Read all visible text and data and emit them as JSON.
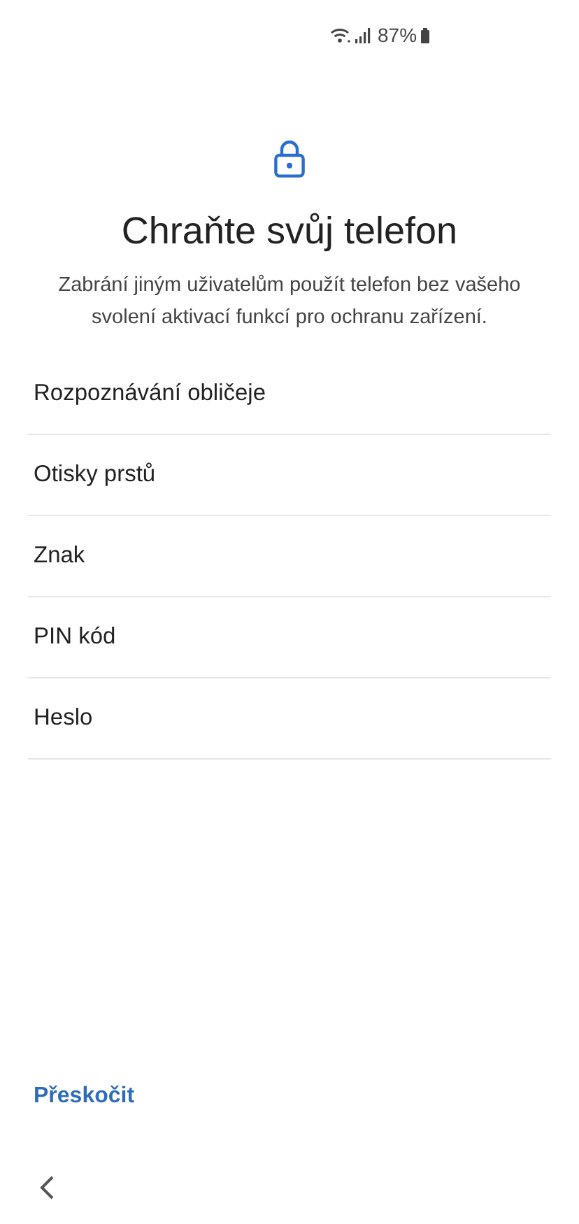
{
  "status_bar": {
    "battery": "87%"
  },
  "title": "Chraňte svůj telefon",
  "description": "Zabrání jiným uživatelům použít telefon bez vašeho svolení aktivací funkcí pro ochranu zařízení.",
  "options": [
    {
      "label": "Rozpoznávání obličeje"
    },
    {
      "label": "Otisky prstů"
    },
    {
      "label": "Znak"
    },
    {
      "label": "PIN kód"
    },
    {
      "label": "Heslo"
    }
  ],
  "skip_button": "Přeskočit"
}
